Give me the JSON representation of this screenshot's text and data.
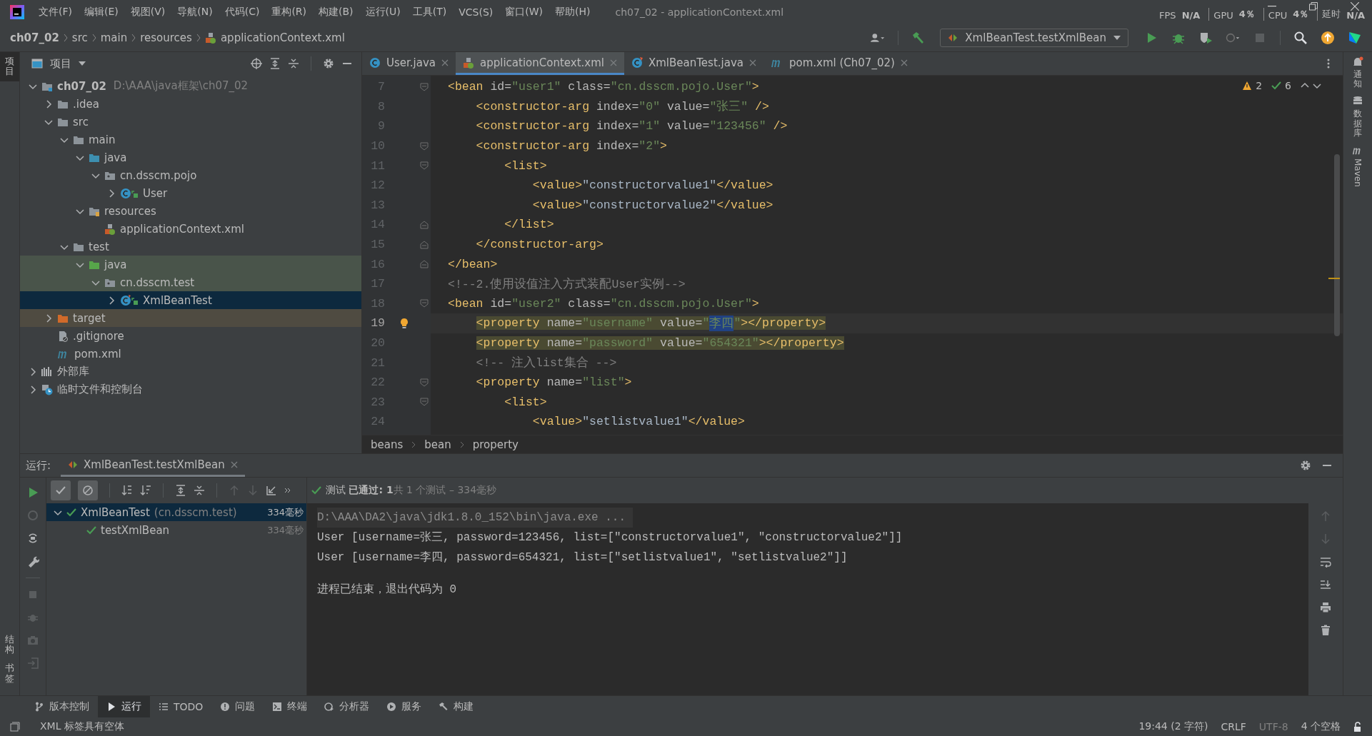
{
  "window": {
    "title": "ch07_02 - applicationContext.xml"
  },
  "menu": [
    "文件(F)",
    "编辑(E)",
    "视图(V)",
    "导航(N)",
    "代码(C)",
    "重构(R)",
    "构建(B)",
    "运行(U)",
    "工具(T)",
    "VCS(S)",
    "窗口(W)",
    "帮助(H)"
  ],
  "perf": [
    {
      "label": "FPS",
      "value": "N/A"
    },
    {
      "label": "GPU",
      "value": "4％"
    },
    {
      "label": "CPU",
      "value": "4％"
    },
    {
      "label": "延时",
      "value": "N/A"
    }
  ],
  "breadcrumb": [
    {
      "label": "ch07_02",
      "kind": "project"
    },
    {
      "label": "src",
      "kind": "folder"
    },
    {
      "label": "main",
      "kind": "folder"
    },
    {
      "label": "resources",
      "kind": "folder"
    },
    {
      "label": "applicationContext.xml",
      "kind": "xml"
    }
  ],
  "run_config": "XmlBeanTest.testXmlBean",
  "left_strip": [
    {
      "label": "项目",
      "selected": true
    }
  ],
  "left_strip_bottom": [
    {
      "label": "结构"
    },
    {
      "label": "书签"
    }
  ],
  "right_strip": [
    {
      "label": "通知",
      "kind": "bell"
    },
    {
      "label": "数据库",
      "kind": "db"
    },
    {
      "label": "Maven",
      "kind": "maven"
    }
  ],
  "project_panel": {
    "title": "项目",
    "tree": [
      {
        "label": "ch07_02",
        "path": "D:\\AAA\\java框架\\ch07_02",
        "kind": "module",
        "expanded": true,
        "selected": false,
        "children": [
          {
            "label": ".idea",
            "kind": "folder",
            "expanded": false,
            "selected": false
          },
          {
            "label": "src",
            "kind": "folder",
            "expanded": true,
            "selected": false,
            "children": [
              {
                "label": "main",
                "kind": "folder",
                "expanded": true,
                "selected": false,
                "children": [
                  {
                    "label": "java",
                    "kind": "source",
                    "expanded": true,
                    "selected": false,
                    "children": [
                      {
                        "label": "cn.dsscm.pojo",
                        "kind": "package",
                        "expanded": true,
                        "selected": false,
                        "children": [
                          {
                            "label": "User",
                            "kind": "class",
                            "expanded": false,
                            "selected": false
                          }
                        ]
                      }
                    ]
                  },
                  {
                    "label": "resources",
                    "kind": "resources",
                    "expanded": true,
                    "selected": false,
                    "children": [
                      {
                        "label": "applicationContext.xml",
                        "kind": "xml",
                        "selected": false
                      }
                    ]
                  }
                ]
              },
              {
                "label": "test",
                "kind": "folder",
                "expanded": true,
                "selected": false,
                "children": [
                  {
                    "label": "java",
                    "kind": "test-source",
                    "expanded": true,
                    "selected": false,
                    "children": [
                      {
                        "label": "cn.dsscm.test",
                        "kind": "test-package",
                        "expanded": true,
                        "selected": false,
                        "children": [
                          {
                            "label": "XmlBeanTest",
                            "kind": "test-class",
                            "expanded": false,
                            "selected": true
                          }
                        ]
                      }
                    ]
                  }
                ]
              }
            ]
          },
          {
            "label": "target",
            "kind": "excluded",
            "expanded": false,
            "selected": false
          },
          {
            "label": ".gitignore",
            "kind": "ignore",
            "selected": false
          },
          {
            "label": "pom.xml",
            "kind": "maven",
            "selected": false
          }
        ]
      },
      {
        "label": "外部库",
        "kind": "libraries",
        "expanded": false,
        "selected": false
      },
      {
        "label": "临时文件和控制台",
        "kind": "scratches",
        "expanded": false,
        "selected": false
      }
    ]
  },
  "editor": {
    "tabs": [
      {
        "label": "User.java",
        "kind": "class",
        "selected": false
      },
      {
        "label": "applicationContext.xml",
        "kind": "xml",
        "selected": true
      },
      {
        "label": "XmlBeanTest.java",
        "kind": "test-class",
        "selected": false
      },
      {
        "label": "pom.xml (Ch07_02)",
        "kind": "maven",
        "selected": false
      }
    ],
    "warnings": "2",
    "checks": "6",
    "lines": [
      {
        "number": "7",
        "fold_start": true,
        "fold_end": false,
        "current": false,
        "highlighted": false,
        "bulb": false,
        "code": [
          {
            "kind": "tag",
            "text": "<bean "
          },
          {
            "kind": "attr",
            "text": "id="
          },
          {
            "kind": "str",
            "text": "\"user1\" "
          },
          {
            "kind": "attr",
            "text": "class="
          },
          {
            "kind": "str",
            "text": "\"cn.dsscm.pojo.User\""
          },
          {
            "kind": "tag",
            "text": ">"
          }
        ]
      },
      {
        "number": "8",
        "fold_start": false,
        "fold_end": false,
        "current": false,
        "highlighted": false,
        "bulb": false,
        "code": [
          {
            "kind": "tag",
            "text": "    <constructor-arg "
          },
          {
            "kind": "attr",
            "text": "index="
          },
          {
            "kind": "str",
            "text": "\"0\" "
          },
          {
            "kind": "attr",
            "text": "value="
          },
          {
            "kind": "str",
            "text": "\"张三\" "
          },
          {
            "kind": "tag",
            "text": "/>"
          }
        ]
      },
      {
        "number": "9",
        "fold_start": false,
        "fold_end": false,
        "current": false,
        "highlighted": false,
        "bulb": false,
        "code": [
          {
            "kind": "tag",
            "text": "    <constructor-arg "
          },
          {
            "kind": "attr",
            "text": "index="
          },
          {
            "kind": "str",
            "text": "\"1\" "
          },
          {
            "kind": "attr",
            "text": "value="
          },
          {
            "kind": "str",
            "text": "\"123456\" "
          },
          {
            "kind": "tag",
            "text": "/>"
          }
        ]
      },
      {
        "number": "10",
        "fold_start": true,
        "fold_end": false,
        "current": false,
        "highlighted": false,
        "bulb": false,
        "code": [
          {
            "kind": "tag",
            "text": "    <constructor-arg "
          },
          {
            "kind": "attr",
            "text": "index="
          },
          {
            "kind": "str",
            "text": "\"2\""
          },
          {
            "kind": "tag",
            "text": ">"
          }
        ]
      },
      {
        "number": "11",
        "fold_start": true,
        "fold_end": false,
        "current": false,
        "highlighted": false,
        "bulb": false,
        "code": [
          {
            "kind": "tag",
            "text": "        <list>"
          }
        ]
      },
      {
        "number": "12",
        "fold_start": false,
        "fold_end": false,
        "current": false,
        "highlighted": false,
        "bulb": false,
        "code": [
          {
            "kind": "tag",
            "text": "            <value>"
          },
          {
            "kind": "text",
            "text": "\"constructorvalue1\""
          },
          {
            "kind": "tag",
            "text": "</value>"
          }
        ]
      },
      {
        "number": "13",
        "fold_start": false,
        "fold_end": false,
        "current": false,
        "highlighted": false,
        "bulb": false,
        "code": [
          {
            "kind": "tag",
            "text": "            <value>"
          },
          {
            "kind": "text",
            "text": "\"constructorvalue2\""
          },
          {
            "kind": "tag",
            "text": "</value>"
          }
        ]
      },
      {
        "number": "14",
        "fold_start": false,
        "fold_end": true,
        "current": false,
        "highlighted": false,
        "bulb": false,
        "code": [
          {
            "kind": "tag",
            "text": "        </list>"
          }
        ]
      },
      {
        "number": "15",
        "fold_start": false,
        "fold_end": true,
        "current": false,
        "highlighted": false,
        "bulb": false,
        "code": [
          {
            "kind": "tag",
            "text": "    </constructor-arg>"
          }
        ]
      },
      {
        "number": "16",
        "fold_start": false,
        "fold_end": true,
        "current": false,
        "highlighted": false,
        "bulb": false,
        "code": [
          {
            "kind": "tag",
            "text": "</bean>"
          }
        ]
      },
      {
        "number": "17",
        "fold_start": false,
        "fold_end": false,
        "current": false,
        "highlighted": false,
        "bulb": false,
        "code": [
          {
            "kind": "comment",
            "text": "<!--2.使用设值注入方式装配User实例-->"
          }
        ]
      },
      {
        "number": "18",
        "fold_start": true,
        "fold_end": false,
        "current": false,
        "highlighted": false,
        "bulb": false,
        "code": [
          {
            "kind": "tag",
            "text": "<bean "
          },
          {
            "kind": "attr",
            "text": "id="
          },
          {
            "kind": "str",
            "text": "\"user2\" "
          },
          {
            "kind": "attr",
            "text": "class="
          },
          {
            "kind": "str",
            "text": "\"cn.dsscm.pojo.User\""
          },
          {
            "kind": "tag",
            "text": ">"
          }
        ]
      },
      {
        "number": "19",
        "fold_start": false,
        "fold_end": false,
        "current": true,
        "highlighted": true,
        "bulb": true,
        "code": [
          {
            "kind": "tag",
            "text": "    <property "
          },
          {
            "kind": "attr",
            "text": "name="
          },
          {
            "kind": "str",
            "text": "\"username\" "
          },
          {
            "kind": "attr",
            "text": "value="
          },
          {
            "kind": "str",
            "text": "\""
          },
          {
            "kind": "selection",
            "text": "李四"
          },
          {
            "kind": "str",
            "text": "\""
          },
          {
            "kind": "tag",
            "text": "></property>"
          }
        ]
      },
      {
        "number": "20",
        "fold_start": false,
        "fold_end": false,
        "current": false,
        "highlighted": true,
        "bulb": false,
        "code": [
          {
            "kind": "tag",
            "text": "    <property "
          },
          {
            "kind": "attr",
            "text": "name="
          },
          {
            "kind": "str",
            "text": "\"password\" "
          },
          {
            "kind": "attr",
            "text": "value="
          },
          {
            "kind": "str",
            "text": "\"654321\""
          },
          {
            "kind": "tag",
            "text": "></property>"
          }
        ]
      },
      {
        "number": "21",
        "fold_start": false,
        "fold_end": false,
        "current": false,
        "highlighted": false,
        "bulb": false,
        "code": [
          {
            "kind": "comment",
            "text": "    <!-- 注入list集合 -->"
          }
        ]
      },
      {
        "number": "22",
        "fold_start": true,
        "fold_end": false,
        "current": false,
        "highlighted": false,
        "bulb": false,
        "code": [
          {
            "kind": "tag",
            "text": "    <property "
          },
          {
            "kind": "attr",
            "text": "name="
          },
          {
            "kind": "str",
            "text": "\"list\""
          },
          {
            "kind": "tag",
            "text": ">"
          }
        ]
      },
      {
        "number": "23",
        "fold_start": true,
        "fold_end": false,
        "current": false,
        "highlighted": false,
        "bulb": false,
        "code": [
          {
            "kind": "tag",
            "text": "        <list>"
          }
        ]
      },
      {
        "number": "24",
        "fold_start": false,
        "fold_end": false,
        "current": false,
        "highlighted": false,
        "bulb": false,
        "code": [
          {
            "kind": "tag",
            "text": "            <value>"
          },
          {
            "kind": "text",
            "text": "\"setlistvalue1\""
          },
          {
            "kind": "tag",
            "text": "</value>"
          }
        ]
      }
    ],
    "path": [
      "beans",
      "bean",
      "property"
    ]
  },
  "run_panel": {
    "label": "运行:",
    "tab": "XmlBeanTest.testXmlBean",
    "status": {
      "prefix": "测试",
      "passed": "已通过: 1",
      "detail": "共 1 个测试 – 334毫秒"
    },
    "tests": [
      {
        "label": "XmlBeanTest",
        "note": "(cn.dsscm.test)",
        "time": "334毫秒",
        "selected": true,
        "children": [
          {
            "label": "testXmlBean",
            "time": "334毫秒",
            "selected": false
          }
        ]
      }
    ],
    "console": [
      {
        "kind": "command",
        "text": "D:\\AAA\\DA2\\java\\jdk1.8.0_152\\bin\\java.exe ..."
      },
      {
        "kind": "output",
        "text": "User [username=张三, password=123456, list=[\"constructorvalue1\", \"constructorvalue2\"]]"
      },
      {
        "kind": "output",
        "text": "User [username=李四, password=654321, list=[\"setlistvalue1\", \"setlistvalue2\"]]"
      },
      {
        "kind": "exit",
        "text": "进程已结束，退出代码为 0"
      }
    ]
  },
  "tool_tabs": [
    {
      "label": "版本控制",
      "kind": "vcs",
      "selected": false
    },
    {
      "label": "运行",
      "kind": "run",
      "selected": true
    },
    {
      "label": "TODO",
      "kind": "todo",
      "selected": false
    },
    {
      "label": "问题",
      "kind": "problems",
      "selected": false
    },
    {
      "label": "终端",
      "kind": "terminal",
      "selected": false
    },
    {
      "label": "分析器",
      "kind": "profiler",
      "selected": false
    },
    {
      "label": "服务",
      "kind": "services",
      "selected": false
    },
    {
      "label": "构建",
      "kind": "build",
      "selected": false
    }
  ],
  "status_bar": {
    "message": "XML 标签具有空体",
    "position": "19:44 (2 字符)",
    "line_ending": "CRLF",
    "encoding": "UTF-8",
    "indent": "4 个空格"
  }
}
